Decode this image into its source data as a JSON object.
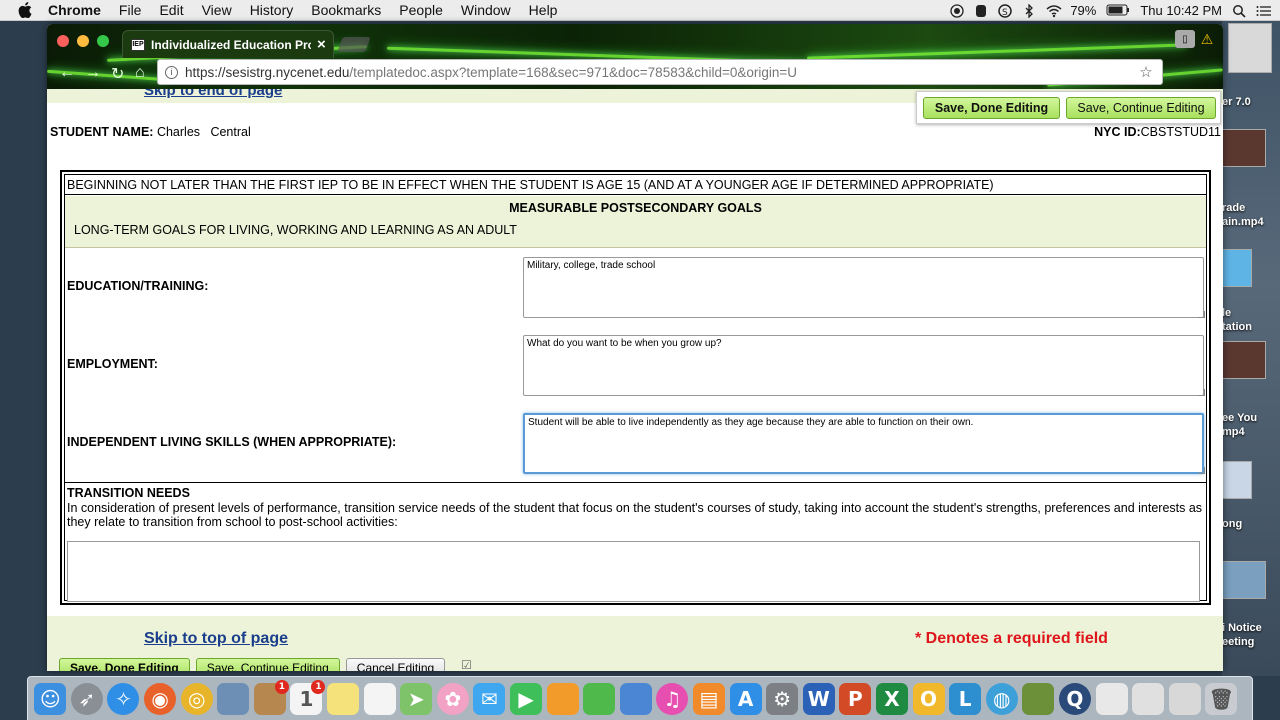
{
  "menubar": {
    "app": "Chrome",
    "items": [
      "File",
      "Edit",
      "View",
      "History",
      "Bookmarks",
      "People",
      "Window",
      "Help"
    ],
    "battery": "79%",
    "clock": "Thu 10:42 PM"
  },
  "browser": {
    "tab_title": "Individualized Education Prog",
    "url_host": "https://sesistrg.nycenet.edu",
    "url_path": "/templatedoc.aspx?template=168&sec=971&doc=78583&child=0&origin=U"
  },
  "desktop": {
    "items": [
      "er 7.0",
      "rade\nain.mp4",
      "le\ntation",
      "ee You\nmp4",
      "ong",
      "i Notice\neeting"
    ]
  },
  "page": {
    "skip_end_label": "Skip to end of page",
    "save_done_label": "Save, Done Editing",
    "save_continue_label": "Save, Continue Editing",
    "student_label": "STUDENT NAME:",
    "student_name": "Charles   Central",
    "nyc_id_label": "NYC ID:",
    "nyc_id": "CBSTSTUD11",
    "header_text": "BEGINNING NOT LATER THAN THE FIRST IEP TO BE IN EFFECT WHEN THE STUDENT IS AGE 15 (AND AT A YOUNGER AGE IF DETERMINED APPROPRIATE)",
    "section_title": "MEASURABLE POSTSECONDARY GOALS",
    "section_subtitle": "LONG-TERM GOALS FOR LIVING, WORKING AND LEARNING AS AN ADULT",
    "fields": [
      {
        "label": "EDUCATION/TRAINING:",
        "value": "Military, college, trade school"
      },
      {
        "label": "EMPLOYMENT:",
        "value": "What do you want to be when you grow up?"
      },
      {
        "label": "INDEPENDENT LIVING SKILLS (WHEN APPROPRIATE):",
        "value": "Student will be able to live independently as they age because they are able to function on their own."
      }
    ],
    "transition_title": "TRANSITION NEEDS",
    "transition_desc": "In consideration of present levels of performance, transition service needs of the student that focus on the student's courses of study, taking into account the student's strengths, preferences and interests as they relate to transition from school to post-school activities:",
    "transition_value": "",
    "skip_top_label": "Skip to top of page",
    "required_note": "* Denotes a required field",
    "bottom_buttons": [
      "Save, Done Editing",
      "Save, Continue Editing",
      "Cancel Editing"
    ]
  },
  "dock": {
    "apps": [
      {
        "name": "finder-icon",
        "color": "#3d8fe0"
      },
      {
        "name": "launchpad-icon",
        "color": "#8a8f96"
      },
      {
        "name": "safari-icon",
        "color": "#2f8ee6"
      },
      {
        "name": "firefox-icon",
        "color": "#e8612a"
      },
      {
        "name": "chrome-icon",
        "color": "#e8b52a"
      },
      {
        "name": "preview-icon",
        "color": "#6d8fb6"
      },
      {
        "name": "contacts-icon",
        "color": "#b6874e"
      },
      {
        "name": "calendar-icon",
        "color": "#f4f4f4"
      },
      {
        "name": "notes-icon",
        "color": "#f6e27a"
      },
      {
        "name": "reminders-icon",
        "color": "#f4f4f4"
      },
      {
        "name": "maps-icon",
        "color": "#7ec26a"
      },
      {
        "name": "photos-icon",
        "color": "#f2a2c4"
      },
      {
        "name": "messages-icon",
        "color": "#3fa6f0"
      },
      {
        "name": "facetime-icon",
        "color": "#3fbf5a"
      },
      {
        "name": "pages-icon",
        "color": "#f39b2a"
      },
      {
        "name": "numbers-icon",
        "color": "#4fba4b"
      },
      {
        "name": "keynote-icon",
        "color": "#4a86d4"
      },
      {
        "name": "itunes-icon",
        "color": "#e64fb0"
      },
      {
        "name": "ibooks-icon",
        "color": "#f08a2a"
      },
      {
        "name": "appstore-icon",
        "color": "#2f8ee6"
      },
      {
        "name": "system-preferences-icon",
        "color": "#7c7f84"
      },
      {
        "name": "word-icon",
        "color": "#2b62b8"
      },
      {
        "name": "powerpoint-icon",
        "color": "#d24a26"
      },
      {
        "name": "excel-icon",
        "color": "#1e8a42"
      },
      {
        "name": "outlook-icon",
        "color": "#f0b82a"
      },
      {
        "name": "lync-icon",
        "color": "#2d8fd0"
      },
      {
        "name": "globe-icon",
        "color": "#3da0d8"
      },
      {
        "name": "minecraft-icon",
        "color": "#6c8f3a"
      },
      {
        "name": "quicktime-icon",
        "color": "#2a4a7a"
      },
      {
        "name": "document-icon",
        "color": "#e8e8e8"
      },
      {
        "name": "mail-doc-icon",
        "color": "#e0e0e0"
      },
      {
        "name": "folder-doc-icon",
        "color": "#d8d8d8"
      },
      {
        "name": "trash-icon",
        "color": "#c8ccd0"
      }
    ]
  }
}
